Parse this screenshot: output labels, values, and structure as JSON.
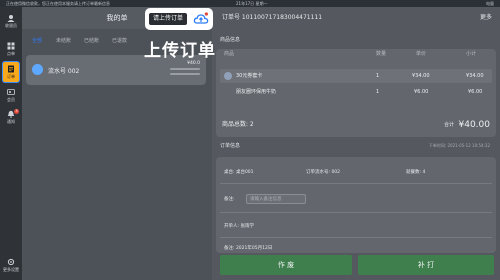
{
  "status_bar": {
    "left": "正在使用微信收款，您正在使用本服务请上传订单最新信息",
    "center": "21年17日 星期一",
    "right": "电量"
  },
  "sidebar": {
    "items": [
      {
        "label": "收银员",
        "icon": "avatar-icon"
      },
      {
        "label": "点单",
        "icon": "grid-icon"
      },
      {
        "label": "订单",
        "icon": "receipt-icon"
      },
      {
        "label": "会员",
        "icon": "member-icon"
      },
      {
        "label": "通知",
        "icon": "bell-icon",
        "badge": "3"
      },
      {
        "label": "更多设置",
        "icon": "settings-icon"
      }
    ],
    "active_index": 2
  },
  "left_panel": {
    "title": "我的单",
    "tabs": [
      "全部",
      "未结账",
      "已结账",
      "已退款"
    ],
    "order": {
      "number": "流水号 002",
      "amount": "¥40.0"
    }
  },
  "tooltip": {
    "label": "请上传订单",
    "caption": "上传订单"
  },
  "right_panel": {
    "order_number": "订单号 101100717183004471111",
    "more": "更多",
    "goods_title": "商品信息",
    "columns": [
      "商品",
      "数量",
      "单价",
      "小计"
    ],
    "items": [
      {
        "name": "30元券套卡",
        "qty": "1",
        "price": "¥34.00",
        "subtotal": "¥34.00"
      },
      {
        "name": "朋友圈环保用牛奶",
        "qty": "1",
        "price": "¥6.00",
        "subtotal": "¥6.00"
      }
    ],
    "count_label": "商品总数: 2",
    "total_label": "合计",
    "total_value": "¥40.00",
    "order_info_title": "订单信息",
    "table_label": "桌台: 桌台001",
    "serial_label": "订单流水号: 002",
    "people_label": "就餐数: 4",
    "remark_label": "备注:",
    "remark_placeholder": "请输入备注信息",
    "operator_label": "开单人: 张雨学",
    "time_label": "备注: 2021年05月12日",
    "created_at": "下单时间: 2021-05-12 10:54:32",
    "btn_left": "作 废",
    "btn_right": "补 打"
  },
  "colors": {
    "accent": "#2e7cf6",
    "active_tab": "#f7a81b",
    "button_green": "#3f7f4d"
  }
}
